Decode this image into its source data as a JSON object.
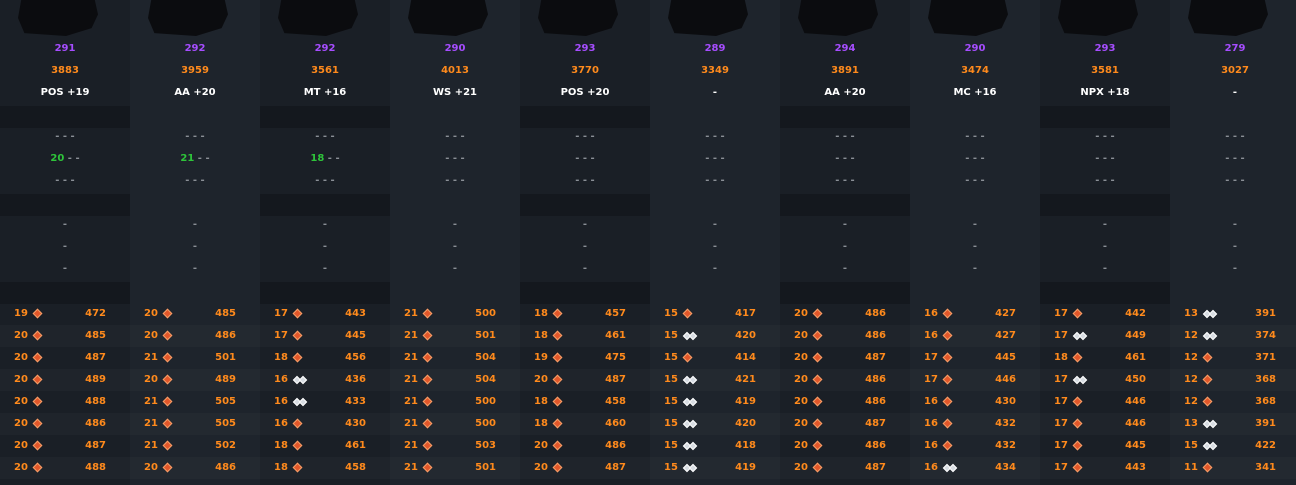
{
  "columns": [
    {
      "ilvl": "291",
      "score": "3883",
      "spec": "POS +19",
      "tiers": [
        "- - -",
        "20 - -",
        "- - -"
      ],
      "tier_green": "20",
      "tier_rest": " - -",
      "enchants": [
        "-",
        "-",
        "-"
      ],
      "gear": [
        [
          "19",
          "orange",
          "472"
        ],
        [
          "20",
          "orange",
          "485"
        ],
        [
          "20",
          "orange",
          "487"
        ],
        [
          "20",
          "orange",
          "489"
        ],
        [
          "20",
          "orange",
          "488"
        ],
        [
          "20",
          "orange",
          "486"
        ],
        [
          "20",
          "orange",
          "487"
        ],
        [
          "20",
          "orange",
          "488"
        ]
      ]
    },
    {
      "ilvl": "292",
      "score": "3959",
      "spec": "AA +20",
      "tiers": [
        "- - -",
        "21 - -",
        "- - -"
      ],
      "tier_green": "21",
      "tier_rest": " - -",
      "enchants": [
        "-",
        "-",
        "-"
      ],
      "gear": [
        [
          "20",
          "orange",
          "485"
        ],
        [
          "20",
          "orange",
          "486"
        ],
        [
          "21",
          "orange",
          "501"
        ],
        [
          "20",
          "orange",
          "489"
        ],
        [
          "21",
          "orange",
          "505"
        ],
        [
          "21",
          "orange",
          "505"
        ],
        [
          "21",
          "orange",
          "502"
        ],
        [
          "20",
          "orange",
          "486"
        ]
      ]
    },
    {
      "ilvl": "292",
      "score": "3561",
      "spec": "MT +16",
      "tiers": [
        "- - -",
        "18 - -",
        "- - -"
      ],
      "tier_green": "18",
      "tier_rest": " - -",
      "enchants": [
        "-",
        "-",
        "-"
      ],
      "gear": [
        [
          "17",
          "orange",
          "443"
        ],
        [
          "17",
          "orange",
          "445"
        ],
        [
          "18",
          "orange",
          "456"
        ],
        [
          "16",
          "white",
          "436"
        ],
        [
          "16",
          "white",
          "433"
        ],
        [
          "16",
          "orange",
          "430"
        ],
        [
          "18",
          "orange",
          "461"
        ],
        [
          "18",
          "orange",
          "458"
        ]
      ]
    },
    {
      "ilvl": "290",
      "score": "4013",
      "spec": "WS +21",
      "tiers": [
        "- - -",
        "- - -",
        "- - -"
      ],
      "tier_green": "",
      "tier_rest": "",
      "enchants": [
        "-",
        "-",
        "-"
      ],
      "gear": [
        [
          "21",
          "orange",
          "500"
        ],
        [
          "21",
          "orange",
          "501"
        ],
        [
          "21",
          "orange",
          "504"
        ],
        [
          "21",
          "orange",
          "504"
        ],
        [
          "21",
          "orange",
          "500"
        ],
        [
          "21",
          "orange",
          "500"
        ],
        [
          "21",
          "orange",
          "503"
        ],
        [
          "21",
          "orange",
          "501"
        ]
      ]
    },
    {
      "ilvl": "293",
      "score": "3770",
      "spec": "POS +20",
      "tiers": [
        "- - -",
        "- - -",
        "- - -"
      ],
      "tier_green": "",
      "tier_rest": "",
      "enchants": [
        "-",
        "-",
        "-"
      ],
      "gear": [
        [
          "18",
          "orange",
          "457"
        ],
        [
          "18",
          "orange",
          "461"
        ],
        [
          "19",
          "orange",
          "475"
        ],
        [
          "20",
          "orange",
          "487"
        ],
        [
          "18",
          "orange",
          "458"
        ],
        [
          "18",
          "orange",
          "460"
        ],
        [
          "20",
          "orange",
          "486"
        ],
        [
          "20",
          "orange",
          "487"
        ]
      ]
    },
    {
      "ilvl": "289",
      "score": "3349",
      "spec": "-",
      "tiers": [
        "- - -",
        "- - -",
        "- - -"
      ],
      "tier_green": "",
      "tier_rest": "",
      "enchants": [
        "-",
        "-",
        "-"
      ],
      "gear": [
        [
          "15",
          "orange",
          "417"
        ],
        [
          "15",
          "white",
          "420"
        ],
        [
          "15",
          "orange",
          "414"
        ],
        [
          "15",
          "white",
          "421"
        ],
        [
          "15",
          "white",
          "419"
        ],
        [
          "15",
          "white",
          "420"
        ],
        [
          "15",
          "white",
          "418"
        ],
        [
          "15",
          "white",
          "419"
        ]
      ]
    },
    {
      "ilvl": "294",
      "score": "3891",
      "spec": "AA +20",
      "tiers": [
        "- - -",
        "- - -",
        "- - -"
      ],
      "tier_green": "",
      "tier_rest": "",
      "enchants": [
        "-",
        "-",
        "-"
      ],
      "gear": [
        [
          "20",
          "orange",
          "486"
        ],
        [
          "20",
          "orange",
          "486"
        ],
        [
          "20",
          "orange",
          "487"
        ],
        [
          "20",
          "orange",
          "486"
        ],
        [
          "20",
          "orange",
          "486"
        ],
        [
          "20",
          "orange",
          "487"
        ],
        [
          "20",
          "orange",
          "486"
        ],
        [
          "20",
          "orange",
          "487"
        ]
      ]
    },
    {
      "ilvl": "290",
      "score": "3474",
      "spec": "MC +16",
      "tiers": [
        "- - -",
        "- - -",
        "- - -"
      ],
      "tier_green": "",
      "tier_rest": "",
      "enchants": [
        "-",
        "-",
        "-"
      ],
      "gear": [
        [
          "16",
          "orange",
          "427"
        ],
        [
          "16",
          "orange",
          "427"
        ],
        [
          "17",
          "orange",
          "445"
        ],
        [
          "17",
          "orange",
          "446"
        ],
        [
          "16",
          "orange",
          "430"
        ],
        [
          "16",
          "orange",
          "432"
        ],
        [
          "16",
          "orange",
          "432"
        ],
        [
          "16",
          "white",
          "434"
        ]
      ]
    },
    {
      "ilvl": "293",
      "score": "3581",
      "spec": "NPX +18",
      "tiers": [
        "- - -",
        "- - -",
        "- - -"
      ],
      "tier_green": "",
      "tier_rest": "",
      "enchants": [
        "-",
        "-",
        "-"
      ],
      "gear": [
        [
          "17",
          "orange",
          "442"
        ],
        [
          "17",
          "white",
          "449"
        ],
        [
          "18",
          "orange",
          "461"
        ],
        [
          "17",
          "white",
          "450"
        ],
        [
          "17",
          "orange",
          "446"
        ],
        [
          "17",
          "orange",
          "446"
        ],
        [
          "17",
          "orange",
          "445"
        ],
        [
          "17",
          "orange",
          "443"
        ]
      ]
    },
    {
      "ilvl": "279",
      "score": "3027",
      "spec": "-",
      "tiers": [
        "- - -",
        "- - -",
        "- - -"
      ],
      "tier_green": "",
      "tier_rest": "",
      "enchants": [
        "-",
        "-",
        "-"
      ],
      "gear": [
        [
          "13",
          "white",
          "391"
        ],
        [
          "12",
          "white",
          "374"
        ],
        [
          "12",
          "orange",
          "371"
        ],
        [
          "12",
          "orange",
          "368"
        ],
        [
          "12",
          "orange",
          "368"
        ],
        [
          "13",
          "white",
          "391"
        ],
        [
          "15",
          "white",
          "422"
        ],
        [
          "11",
          "orange",
          "341"
        ]
      ]
    }
  ],
  "colors": {
    "ilvl": "#a64dff",
    "score": "#ff8a1c",
    "tier_green": "#2ec43a",
    "background": "#1a1f26"
  }
}
